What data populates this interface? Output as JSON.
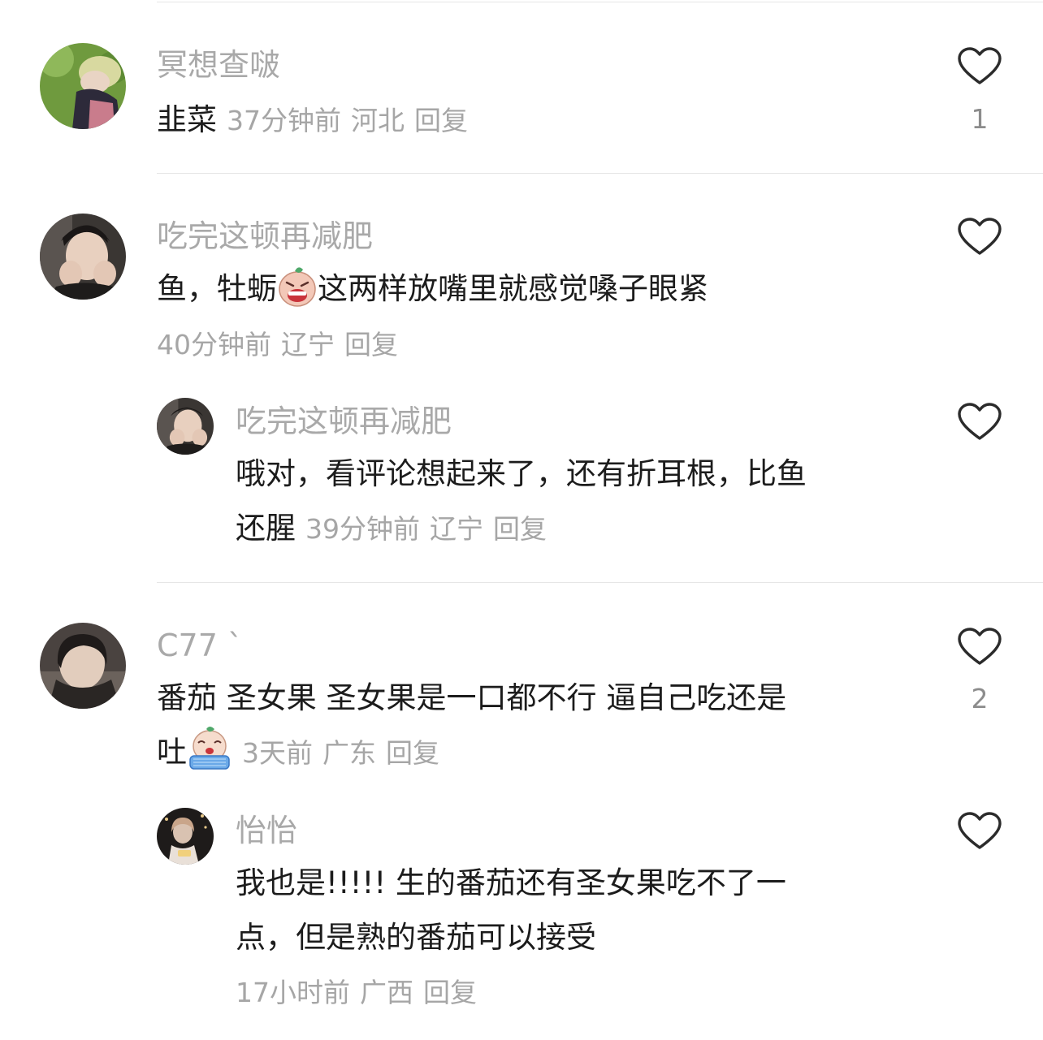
{
  "comments": [
    {
      "username": "冥想查啵",
      "text": "韭菜",
      "time": "37分钟前",
      "location": "河北",
      "reply": "回复",
      "likes": "1"
    },
    {
      "username": "吃完这顿再减肥",
      "text_before_emoji": "鱼，牡蛎",
      "emoji": "grimace-emoji",
      "text_after_emoji": "这两样放嘴里就感觉嗓子眼紧",
      "time": "40分钟前",
      "location": "辽宁",
      "reply": "回复",
      "sub_reply": {
        "username": "吃完这顿再减肥",
        "text_line1": "哦对，看评论想起来了，还有折耳根，比鱼",
        "text_line2": "还腥",
        "time": "39分钟前",
        "location": "辽宁",
        "reply": "回复"
      }
    },
    {
      "username": "C77 `",
      "text_line1": "番茄 圣女果 圣女果是一口都不行 逼自己吃还是",
      "text_line2": "吐",
      "emoji": "crying-emoji",
      "time": "3天前",
      "location": "广东",
      "reply": "回复",
      "likes": "2",
      "sub_reply": {
        "username": "怡怡",
        "text_line1": "我也是!!!!!  生的番茄还有圣女果吃不了一",
        "text_line2": "点，但是熟的番茄可以接受",
        "time": "17小时前",
        "location": "广西",
        "reply": "回复"
      }
    }
  ],
  "icons": {
    "like": "heart-outline-icon"
  },
  "colors": {
    "username": "#a9a9a9",
    "meta": "#a6a6a6",
    "text": "#1c1c1c",
    "divider": "#e6e6e6"
  }
}
